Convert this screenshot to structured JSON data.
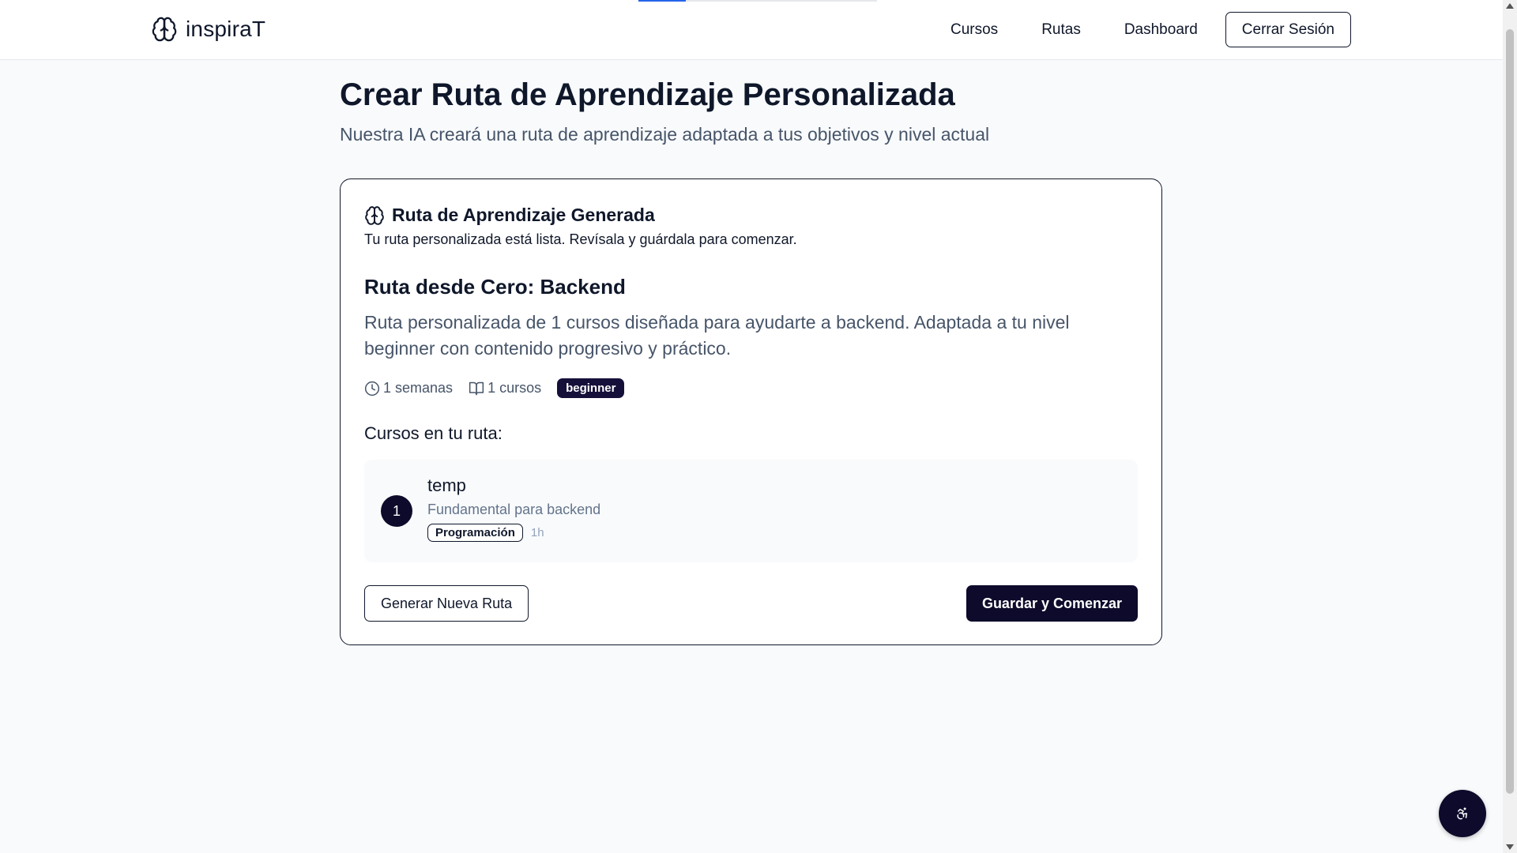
{
  "loading": {
    "progress": 0.2
  },
  "header": {
    "brand": "inspiraT",
    "nav": [
      "Cursos",
      "Rutas",
      "Dashboard"
    ],
    "logout_label": "Cerrar Sesión"
  },
  "page": {
    "title": "Crear Ruta de Aprendizaje Personalizada",
    "subtitle": "Nuestra IA creará una ruta de aprendizaje adaptada a tus objetivos y nivel actual"
  },
  "card": {
    "title": "Ruta de Aprendizaje Generada",
    "description": "Tu ruta personalizada está lista. Revísala y guárdala para comenzar.",
    "route_name": "Ruta desde Cero: Backend",
    "route_description": "Ruta personalizada de 1 cursos diseñada para ayudarte a backend. Adaptada a tu nivel beginner con contenido progresivo y práctico.",
    "duration": "1 semanas",
    "courses_count": "1 cursos",
    "level": "beginner",
    "courses_heading": "Cursos en tu ruta:",
    "courses": [
      {
        "number": "1",
        "title": "temp",
        "subtitle": "Fundamental para backend",
        "category": "Programación",
        "duration": "1h"
      }
    ],
    "regenerate_label": "Generar Nueva Ruta",
    "save_label": "Guardar y Comenzar"
  },
  "icons": {
    "brand": "brain-icon",
    "card_title": "brain-icon",
    "duration": "clock-icon",
    "courses": "book-open-icon",
    "fab": "accessibility-icon"
  },
  "colors": {
    "primary": "#0d0a2b",
    "badge": "#15103a",
    "background": "#f8fafc",
    "loading_bar": "#2563eb"
  }
}
